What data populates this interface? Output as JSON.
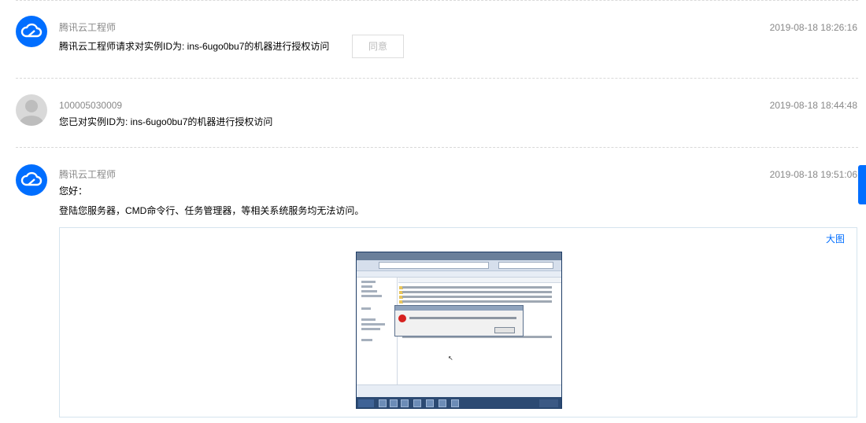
{
  "messages": [
    {
      "sender": "腾讯云工程师",
      "time": "2019-08-18 18:26:16",
      "lines": [
        "腾讯云工程师请求对实例ID为: ins-6ugo0bu7的机器进行授权访问"
      ],
      "button_label": "同意",
      "avatar": "tencent-cloud-icon"
    },
    {
      "sender": "100005030009",
      "time": "2019-08-18 18:44:48",
      "lines": [
        "您已对实例ID为: ins-6ugo0bu7的机器进行授权访问"
      ],
      "avatar": "user-avatar-icon"
    },
    {
      "sender": "腾讯云工程师",
      "time": "2019-08-18 19:51:06",
      "lines": [
        "您好：",
        "登陆您服务器，CMD命令行、任务管理器，等相关系统服务均无法访问。"
      ],
      "attachment_link": "大图",
      "avatar": "tencent-cloud-icon"
    }
  ],
  "colors": {
    "brand": "#006eff",
    "muted_text": "#888888",
    "divider": "#d9d9d9"
  }
}
